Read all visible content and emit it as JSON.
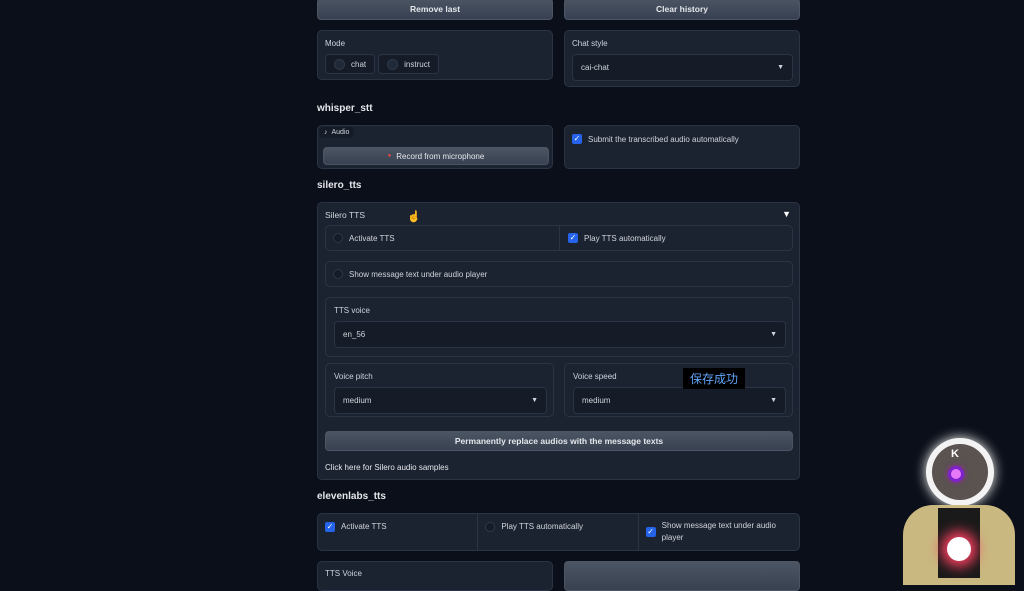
{
  "buttons": {
    "remove_last": "Remove last",
    "clear_history": "Clear history"
  },
  "mode": {
    "label": "Mode",
    "options": [
      "chat",
      "instruct"
    ]
  },
  "chat_style": {
    "label": "Chat style",
    "value": "cai-chat"
  },
  "whisper": {
    "title": "whisper_stt",
    "audio_tab": "Audio",
    "record": "Record from microphone",
    "submit_auto": "Submit the transcribed audio automatically"
  },
  "silero": {
    "title": "silero_tts",
    "accordion": "Silero TTS",
    "activate": "Activate TTS",
    "play_auto": "Play TTS automatically",
    "show_text": "Show message text under audio player",
    "voice_label": "TTS voice",
    "voice": "en_56",
    "pitch_label": "Voice pitch",
    "pitch": "medium",
    "speed_label": "Voice speed",
    "speed": "medium",
    "toast": "保存成功",
    "replace": "Permanently replace audios with the message texts",
    "samples": "Click here for Silero audio samples"
  },
  "eleven": {
    "title": "elevenlabs_tts",
    "activate": "Activate TTS",
    "play_auto": "Play TTS automatically",
    "show_text": "Show message text under audio player",
    "voice_label": "TTS Voice"
  },
  "avatar": {
    "letter": "K"
  }
}
